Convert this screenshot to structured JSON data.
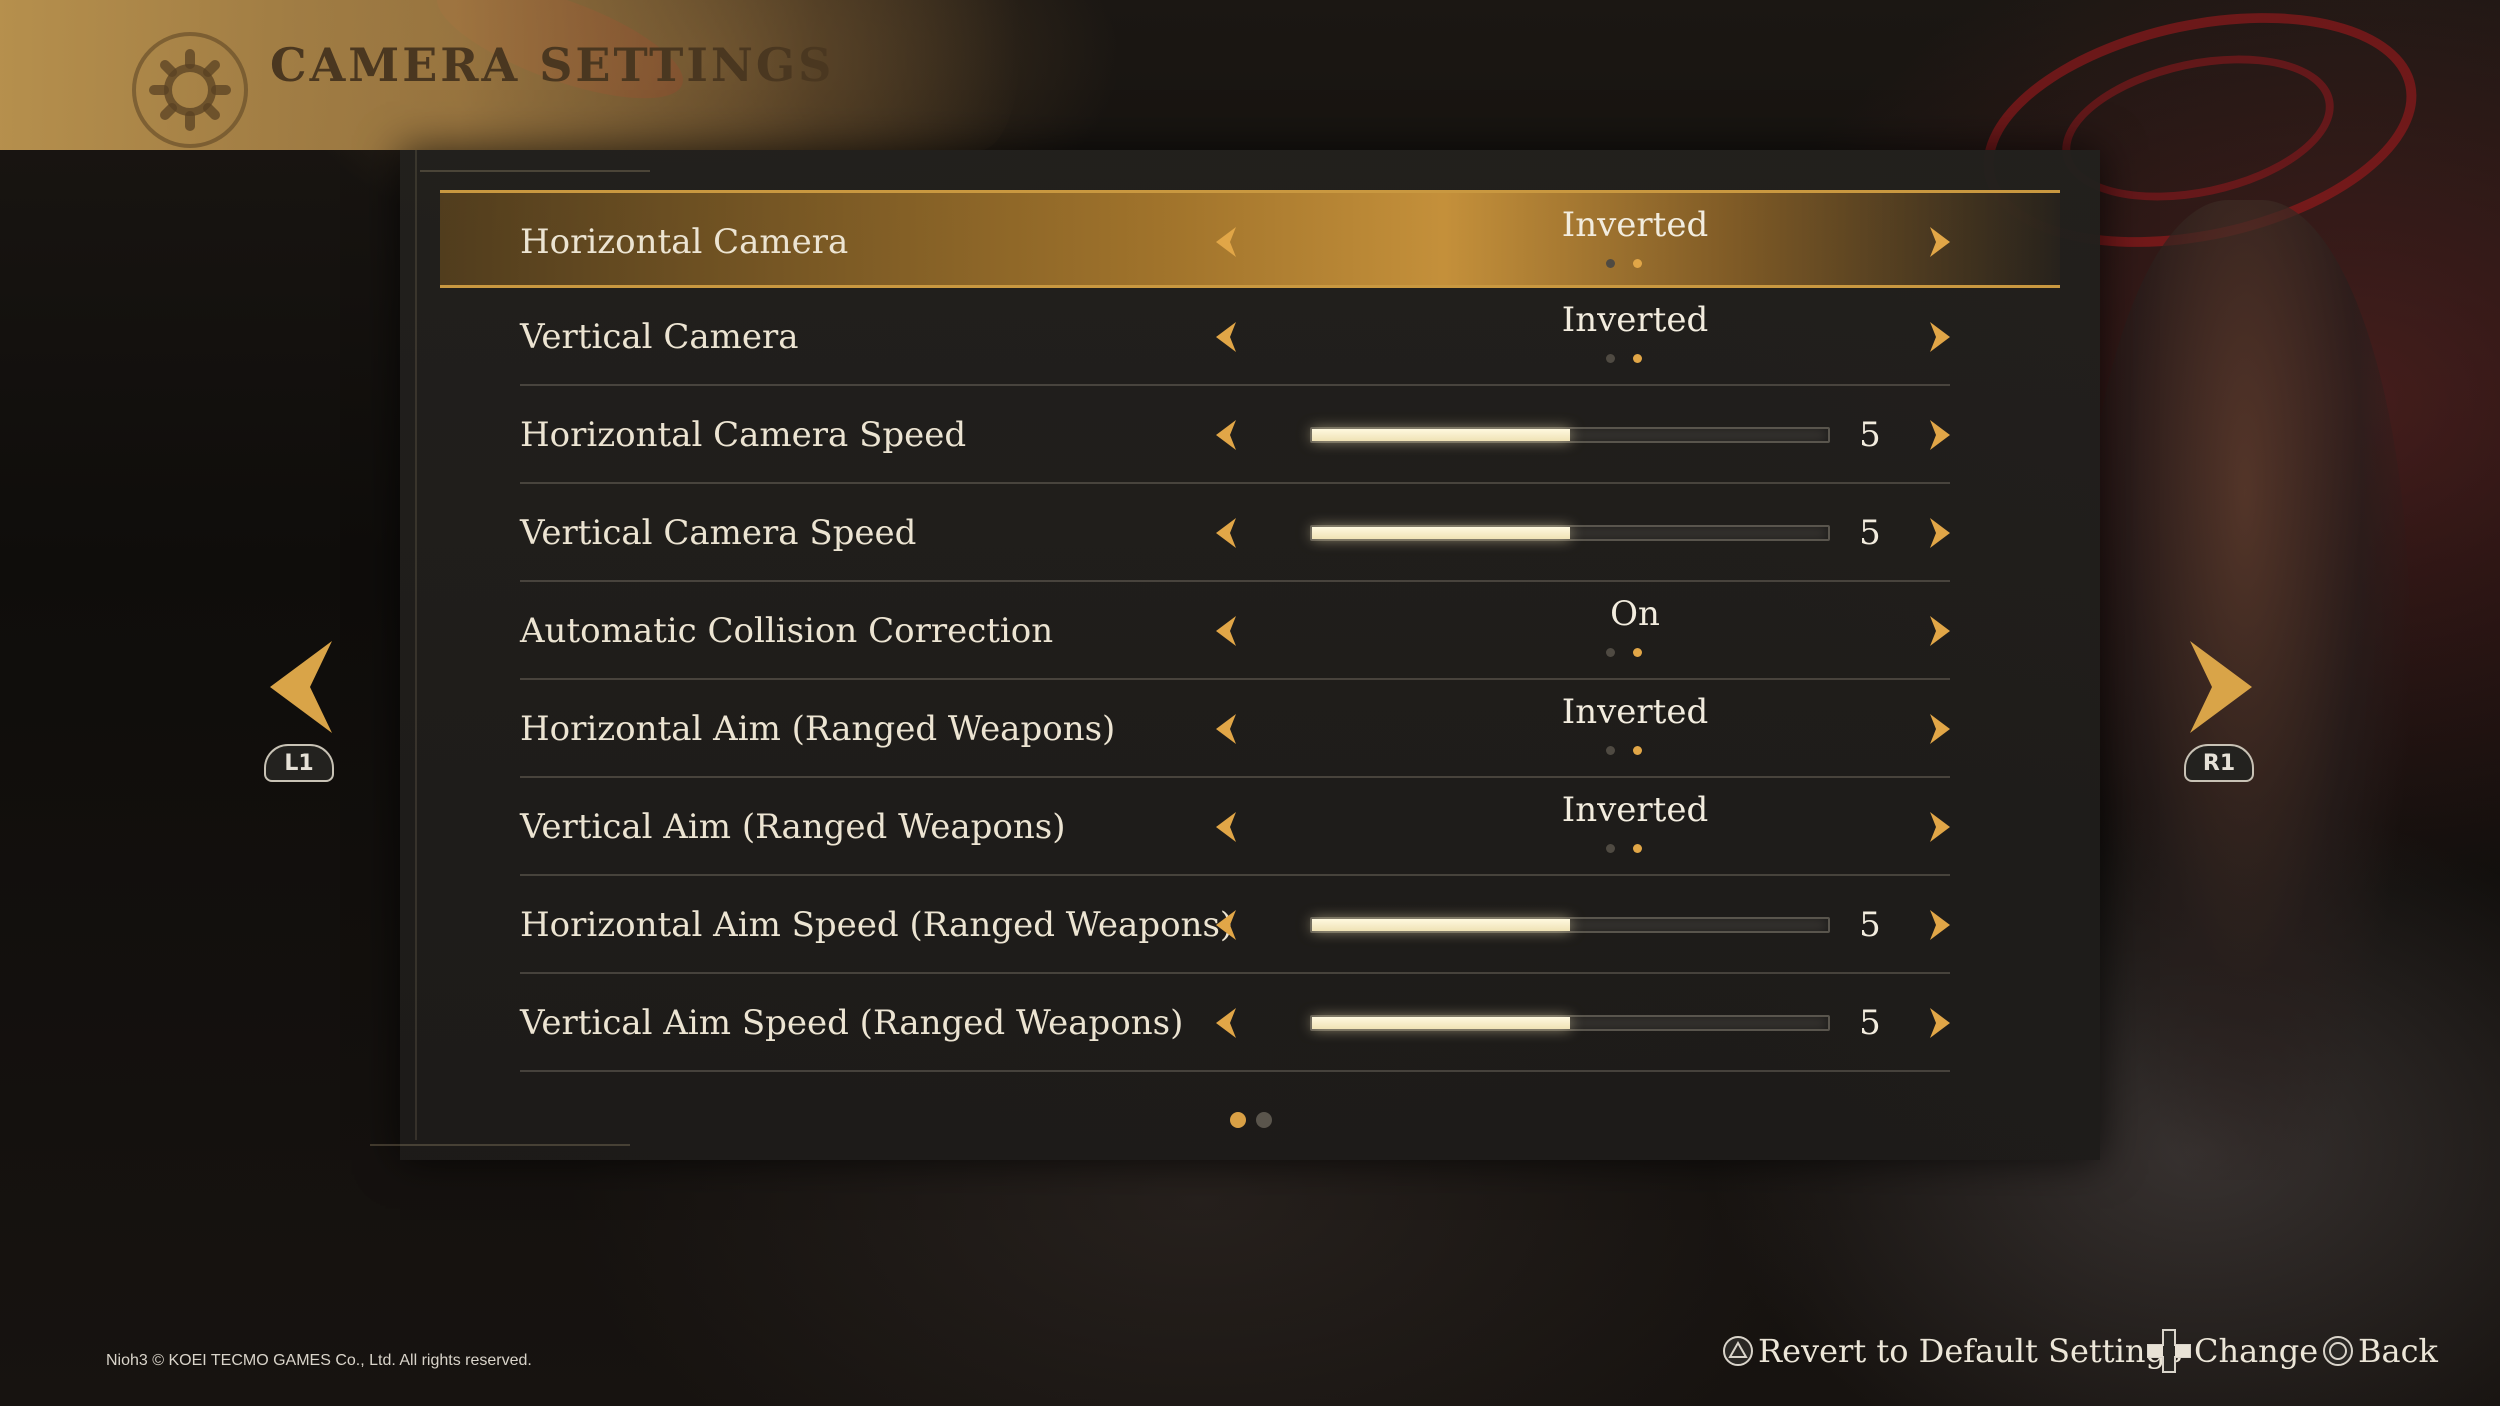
{
  "header": {
    "title": "CAMERA SETTINGS",
    "icon": "gear-icon"
  },
  "settings": [
    {
      "label": "Horizontal Camera",
      "type": "toggle",
      "value": "Inverted",
      "option_index": 2,
      "option_count": 2,
      "selected": true
    },
    {
      "label": "Vertical Camera",
      "type": "toggle",
      "value": "Inverted",
      "option_index": 2,
      "option_count": 2,
      "selected": false
    },
    {
      "label": "Horizontal Camera Speed",
      "type": "slider",
      "value": "5",
      "fill_fraction": 0.5,
      "selected": false
    },
    {
      "label": "Vertical Camera Speed",
      "type": "slider",
      "value": "5",
      "fill_fraction": 0.5,
      "selected": false
    },
    {
      "label": "Automatic Collision Correction",
      "type": "toggle",
      "value": "On",
      "option_index": 2,
      "option_count": 2,
      "selected": false
    },
    {
      "label": "Horizontal Aim (Ranged Weapons)",
      "type": "toggle",
      "value": "Inverted",
      "option_index": 2,
      "option_count": 2,
      "selected": false
    },
    {
      "label": "Vertical Aim (Ranged Weapons)",
      "type": "toggle",
      "value": "Inverted",
      "option_index": 2,
      "option_count": 2,
      "selected": false
    },
    {
      "label": "Horizontal Aim Speed (Ranged Weapons)",
      "type": "slider",
      "value": "5",
      "fill_fraction": 0.5,
      "selected": false
    },
    {
      "label": "Vertical Aim Speed (Ranged Weapons)",
      "type": "slider",
      "value": "5",
      "fill_fraction": 0.5,
      "selected": false
    }
  ],
  "pagination": {
    "current_page": 1,
    "page_count": 2
  },
  "nav": {
    "left_button": "L1",
    "right_button": "R1"
  },
  "footer": {
    "copyright": "Nioh3 © KOEI TECMO GAMES Co., Ltd. All rights reserved.",
    "revert_label": "Revert to Default Settings",
    "revert_icon": "triangle-button-icon",
    "change_label": "Change",
    "change_icon": "dpad-icon",
    "back_label": "Back",
    "back_icon": "circle-button-icon"
  },
  "colors": {
    "accent": "#e1a647",
    "selected_row": "#c99840",
    "text": "#ece4d2",
    "slider_fill": "#efe2b5",
    "panel": "#22201d"
  }
}
